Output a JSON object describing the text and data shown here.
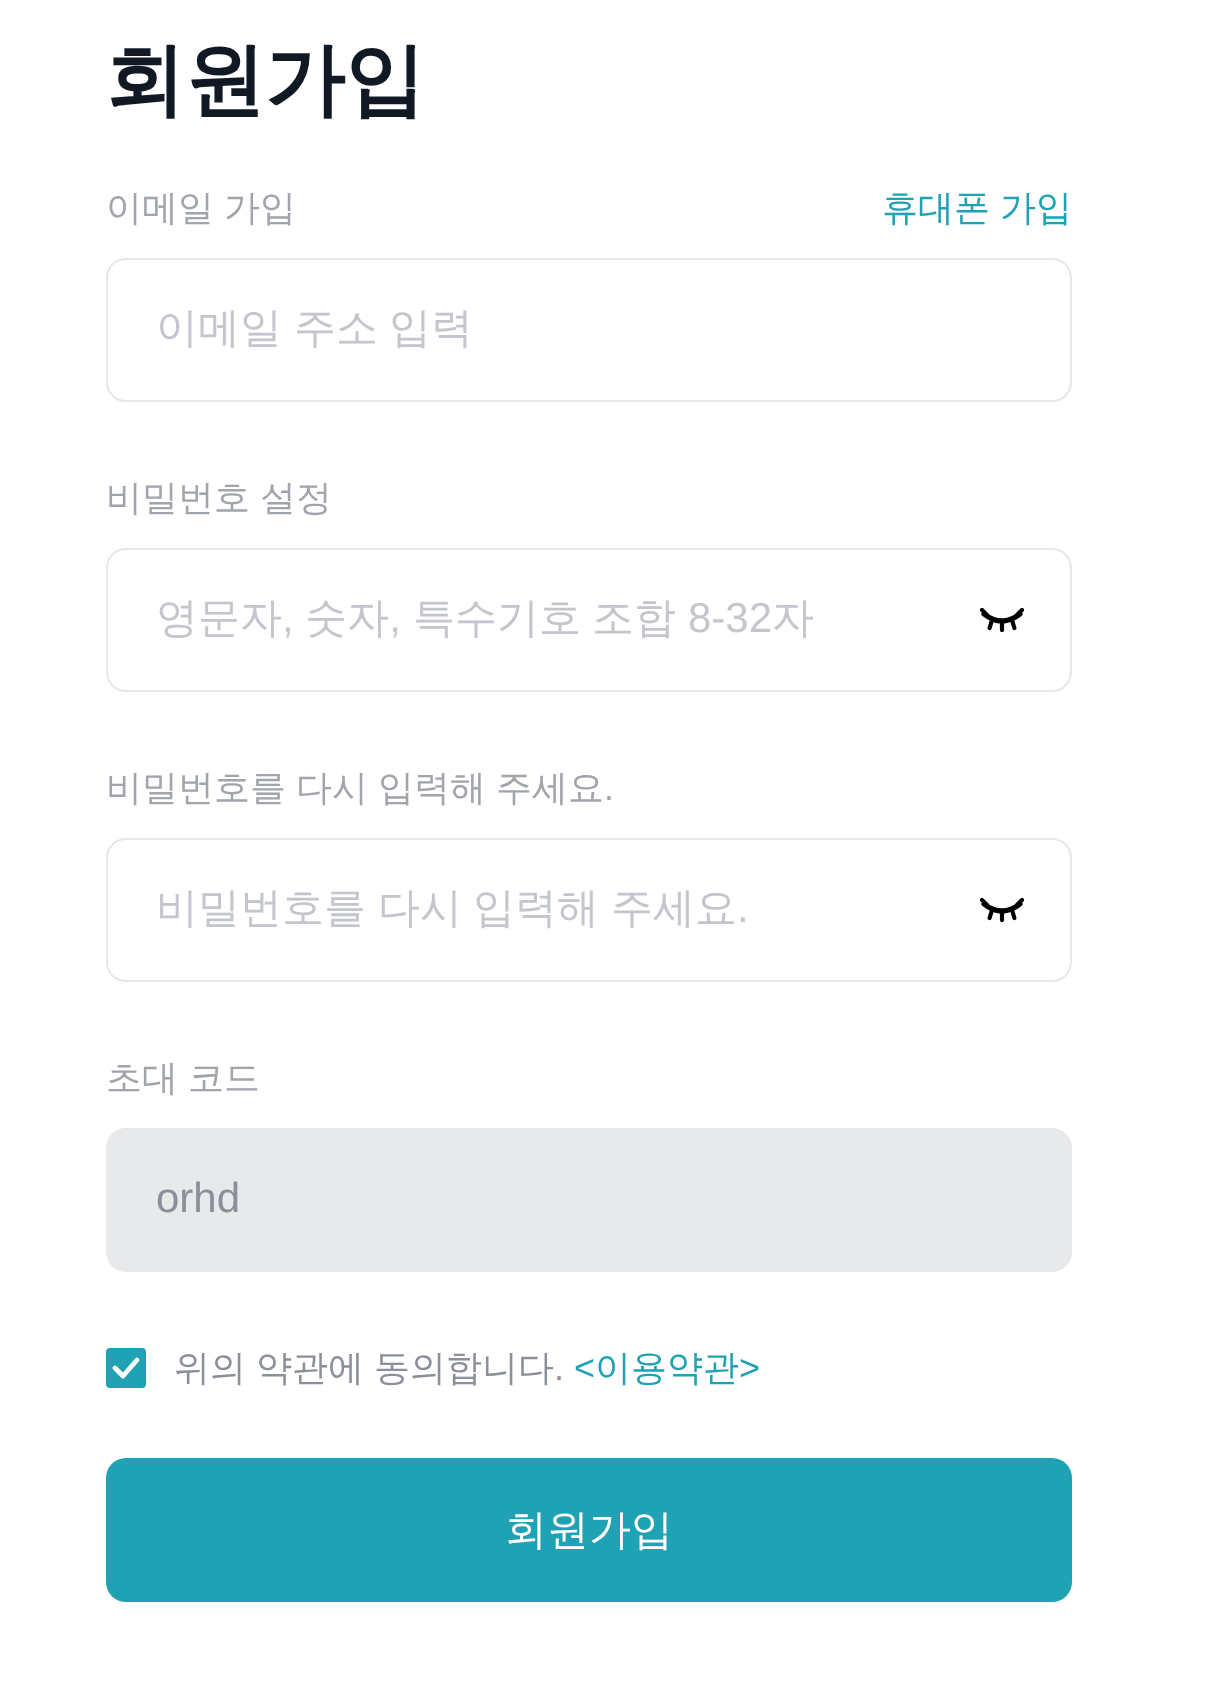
{
  "title": "회원가입",
  "fields": [
    {
      "kind": "email",
      "label": "이메일 가입",
      "link": "휴대폰 가입",
      "placeholder": "이메일 주소 입력",
      "disabled": false
    },
    {
      "kind": "password",
      "label": "비밀번호 설정",
      "placeholder": "영문자, 숫자, 특수기호 조합 8-32자",
      "revealed": false,
      "disabled": false
    },
    {
      "kind": "password",
      "label": "비밀번호를 다시 입력해 주세요.",
      "placeholder": "비밀번호를 다시 입력해 주세요.",
      "revealed": false,
      "disabled": false
    },
    {
      "kind": "text",
      "label": "초대 코드",
      "value": "orhd",
      "disabled": true
    }
  ],
  "agreement": {
    "checked": true,
    "text": "위의 약관에 동의합니다.",
    "link": "<이용약관>"
  },
  "submit": {
    "label": "회원가입"
  }
}
